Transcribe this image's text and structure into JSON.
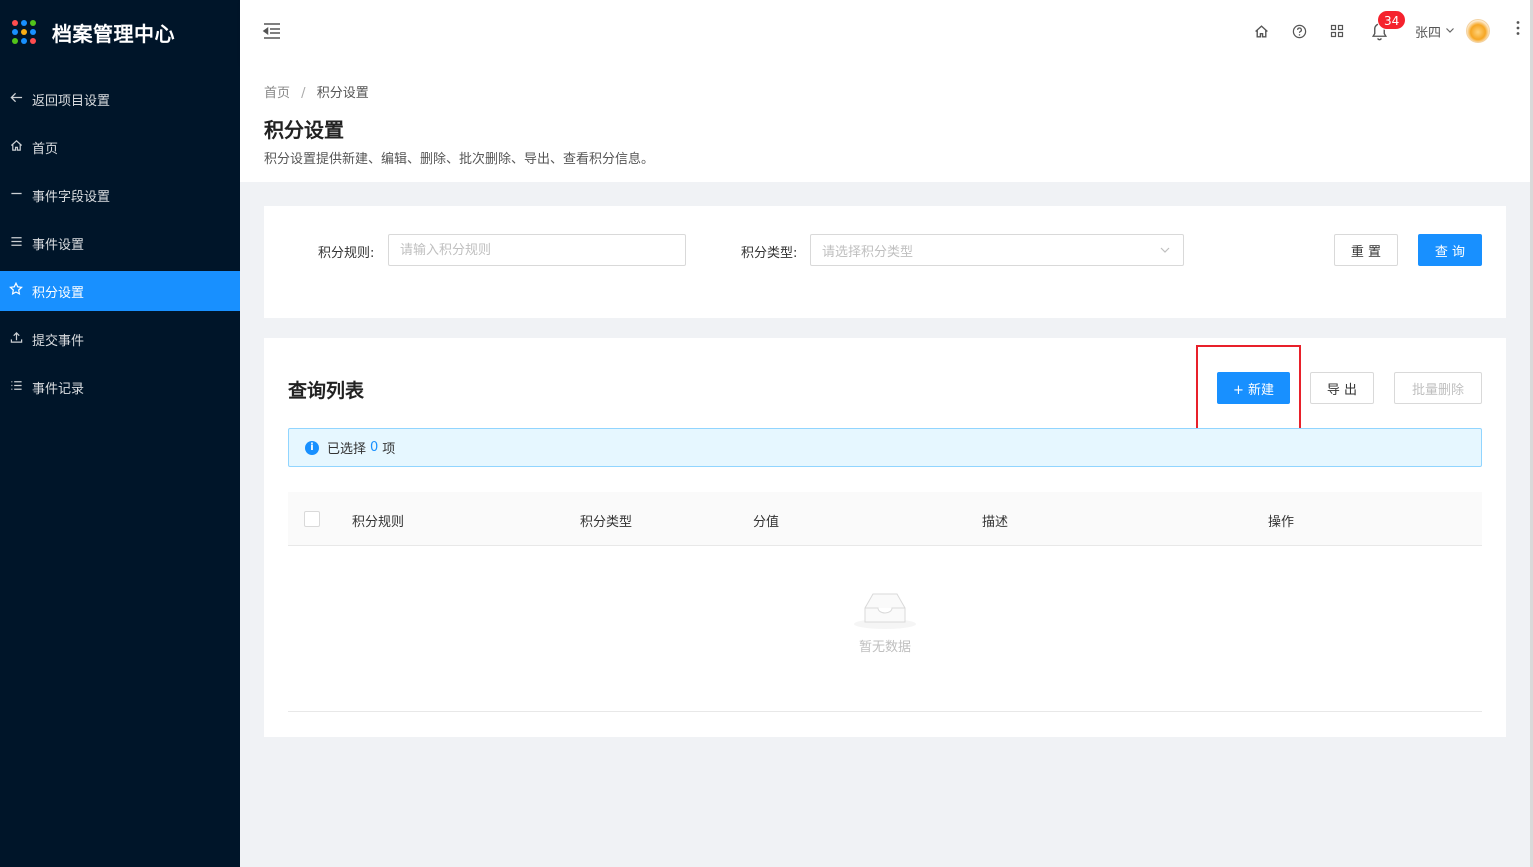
{
  "app": {
    "title": "档案管理中心"
  },
  "sidebar": {
    "items": [
      {
        "label": "返回项目设置",
        "icon": "arrow-left-icon"
      },
      {
        "label": "首页",
        "icon": "home-icon"
      },
      {
        "label": "事件字段设置",
        "icon": "minus-icon"
      },
      {
        "label": "事件设置",
        "icon": "menu-icon"
      },
      {
        "label": "积分设置",
        "icon": "star-icon",
        "active": true
      },
      {
        "label": "提交事件",
        "icon": "upload-icon"
      },
      {
        "label": "事件记录",
        "icon": "list-icon"
      }
    ]
  },
  "header": {
    "notification_count": "34",
    "user_name": "张四"
  },
  "breadcrumb": {
    "home": "首页",
    "separator": "/",
    "current": "积分设置"
  },
  "page": {
    "title": "积分设置",
    "description": "积分设置提供新建、编辑、删除、批次删除、导出、查看积分信息。"
  },
  "search": {
    "rule_label": "积分规则:",
    "rule_placeholder": "请输入积分规则",
    "type_label": "积分类型:",
    "type_placeholder": "请选择积分类型",
    "reset_label": "重 置",
    "query_label": "查 询"
  },
  "list": {
    "title": "查询列表",
    "new_label": "+ 新建",
    "export_label": "导 出",
    "batch_delete_label": "批量删除",
    "selection_prefix": "已选择",
    "selection_count": "0",
    "selection_suffix": "项",
    "columns": [
      "积分规则",
      "积分类型",
      "分值",
      "描述",
      "操作"
    ],
    "empty_text": "暂无数据"
  },
  "colors": {
    "primary": "#1890ff",
    "sidebar_bg": "#001529",
    "highlight": "#e8202a",
    "badge": "#f5222d"
  }
}
